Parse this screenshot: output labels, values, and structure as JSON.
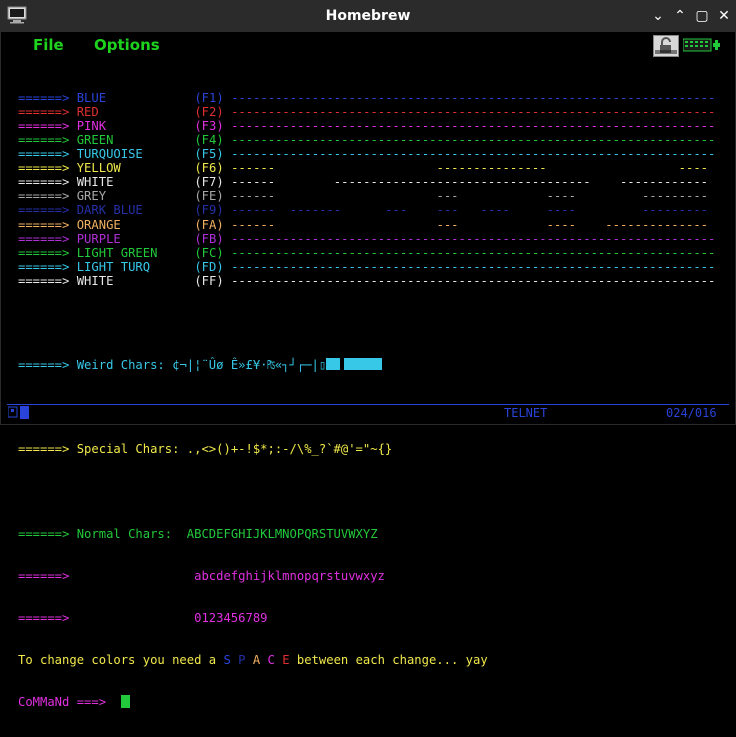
{
  "window": {
    "title": "Homebrew"
  },
  "menu": {
    "file": "File",
    "options": "Options"
  },
  "arrow": "======>",
  "colors": {
    "blue": "#2a43d8",
    "red": "#e03030",
    "pink": "#e030e0",
    "green": "#22c93a",
    "turq": "#37c8e8",
    "yellow": "#f0e84a",
    "white": "#e8e8e8",
    "grey": "#a8a8a8",
    "darkblue": "#2530a8",
    "orange": "#f0b060",
    "purple": "#b030d8",
    "lightgreen": "#22c93a",
    "lightturq": "#37c8e8"
  },
  "rows": [
    {
      "name": "BLUE",
      "key": "(F1)",
      "line": "------------------------------------------------------------------",
      "color": "#2a43d8"
    },
    {
      "name": "RED",
      "key": "(F2)",
      "line": "------------------------------------------------------------------",
      "color": "#e03030"
    },
    {
      "name": "PINK",
      "key": "(F3)",
      "line": "------------------------------------------------------------------",
      "color": "#e030e0"
    },
    {
      "name": "GREEN",
      "key": "(F4)",
      "line": "------------------------------------------------------------------",
      "color": "#22c93a"
    },
    {
      "name": "TURQUOISE",
      "key": "(F5)",
      "line": "------------------------------------------------------------------",
      "color": "#37c8e8"
    },
    {
      "name": "YELLOW",
      "key": "(F6)",
      "line": "------                      ---------------                  ----",
      "color": "#f0e84a"
    },
    {
      "name": "WHITE",
      "key": "(F7)",
      "line": "------        -----------------------------------    ------------",
      "color": "#e8e8e8"
    },
    {
      "name": "GREY",
      "key": "(FE)",
      "line": "------                      ---            ----         ---------",
      "color": "#a8a8a8"
    },
    {
      "name": "DARK BLUE",
      "key": "(F9)",
      "line": "------  -------      ---    ---   ----     ----         ---------",
      "color": "#2530a8"
    },
    {
      "name": "ORANGE",
      "key": "(FA)",
      "line": "------                      ---            ----    --------------",
      "color": "#f0b060"
    },
    {
      "name": "PURPLE",
      "key": "(FB)",
      "line": "------------------------------------------------------------------",
      "color": "#b030d8"
    },
    {
      "name": "LIGHT GREEN",
      "key": "(FC)",
      "line": "------------------------------------------------------------------",
      "color": "#22c93a"
    },
    {
      "name": "LIGHT TURQ",
      "key": "(FD)",
      "line": "------------------------------------------------------------------",
      "color": "#37c8e8"
    },
    {
      "name": "WHITE",
      "key": "(FF)",
      "line": "------------------------------------------------------------------",
      "color": "#e8e8e8"
    }
  ],
  "weird": {
    "label": "Weird Chars:",
    "chars": "¢¬|¦¨Ûø Ê»£¥·₧«┐┘┌─|▯"
  },
  "special": {
    "label": "Special Chars:",
    "chars": ".,<>()+-!$*;:-/\\%_?`#@'=\"~{}"
  },
  "normal": {
    "label": "Normal Chars:",
    "upper": "ABCDEFGHIJKLMNOPQRSTUVWXYZ",
    "lower": "abcdefghijklmnopqrstuvwxyz",
    "digits": "0123456789"
  },
  "message": {
    "before": "To change colors you need a ",
    "s": "S",
    "p": "P",
    "a": "A",
    "c": "C",
    "e": "E",
    "after": " between each change... yay"
  },
  "prompt": "CoMMaNd ===>",
  "status": {
    "mode": "TELNET",
    "position": "024/016"
  }
}
